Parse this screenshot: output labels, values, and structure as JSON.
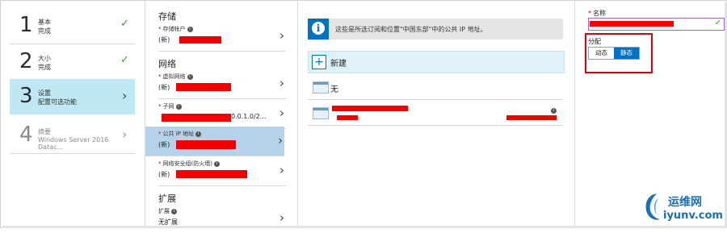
{
  "steps": [
    {
      "num": "1",
      "title": "基本",
      "status": "完成",
      "state": "done"
    },
    {
      "num": "2",
      "title": "大小",
      "status": "完成",
      "state": "done"
    },
    {
      "num": "3",
      "title": "设置",
      "status": "配置可选功能",
      "state": "active"
    },
    {
      "num": "4",
      "title": "摘要",
      "status": "Windows Server 2016 Datac...",
      "state": "disabled"
    }
  ],
  "settings": {
    "storage_header": "存储",
    "network_header": "网络",
    "extension_header": "扩展",
    "storage_account": {
      "label": "存储帐户",
      "value": "(新)"
    },
    "vnet": {
      "label": "虚拟网络",
      "value": "(新)"
    },
    "subnet": {
      "label": "子网",
      "value": "0.0.1.0/2..."
    },
    "public_ip": {
      "label": "公共 IP 地址",
      "value": "(新)"
    },
    "nsg": {
      "label": "网络安全组(防火墙)",
      "value": "(新)"
    },
    "extensions": {
      "label": "扩展",
      "value": "无扩展"
    }
  },
  "ip_panel": {
    "info_text": "这些是所选订阅和位置\"中国东部\"中的公共 IP 地址。",
    "new_label": "新建",
    "none_label": "无"
  },
  "create_ip": {
    "name_label": "名称",
    "allocation_label": "分配",
    "dynamic_label": "动态",
    "static_label": "静态"
  },
  "watermark": {
    "cn": "运维网",
    "en": "iyunv.com"
  },
  "colors": {
    "accent": "#0072c6",
    "active_step": "#bfe8f5",
    "selected_field": "#b5d2e8",
    "check": "#3e9d2f",
    "highlight_box": "#e00000"
  }
}
